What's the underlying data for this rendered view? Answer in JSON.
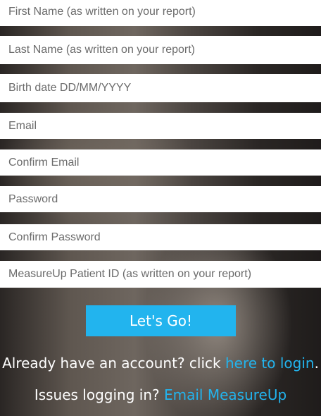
{
  "form": {
    "first_name_placeholder": "First Name (as written on your report)",
    "last_name_placeholder": "Last Name (as written on your report)",
    "birth_date_placeholder": "Birth date DD/MM/YYYY",
    "email_placeholder": "Email",
    "confirm_email_placeholder": "Confirm Email",
    "password_placeholder": "Password",
    "confirm_password_placeholder": "Confirm Password",
    "patient_id_placeholder": "MeasureUp Patient ID (as written on your report)",
    "submit_label": "Let's Go!"
  },
  "footer": {
    "account_text": "Already have an account? click ",
    "account_link": "here to login",
    "account_suffix": ".",
    "issues_text": "Issues logging in? ",
    "issues_link": "Email MeasureUp"
  },
  "colors": {
    "accent": "#22b4ee",
    "field_bg": "#ffffff",
    "text_light": "#ffffff"
  }
}
